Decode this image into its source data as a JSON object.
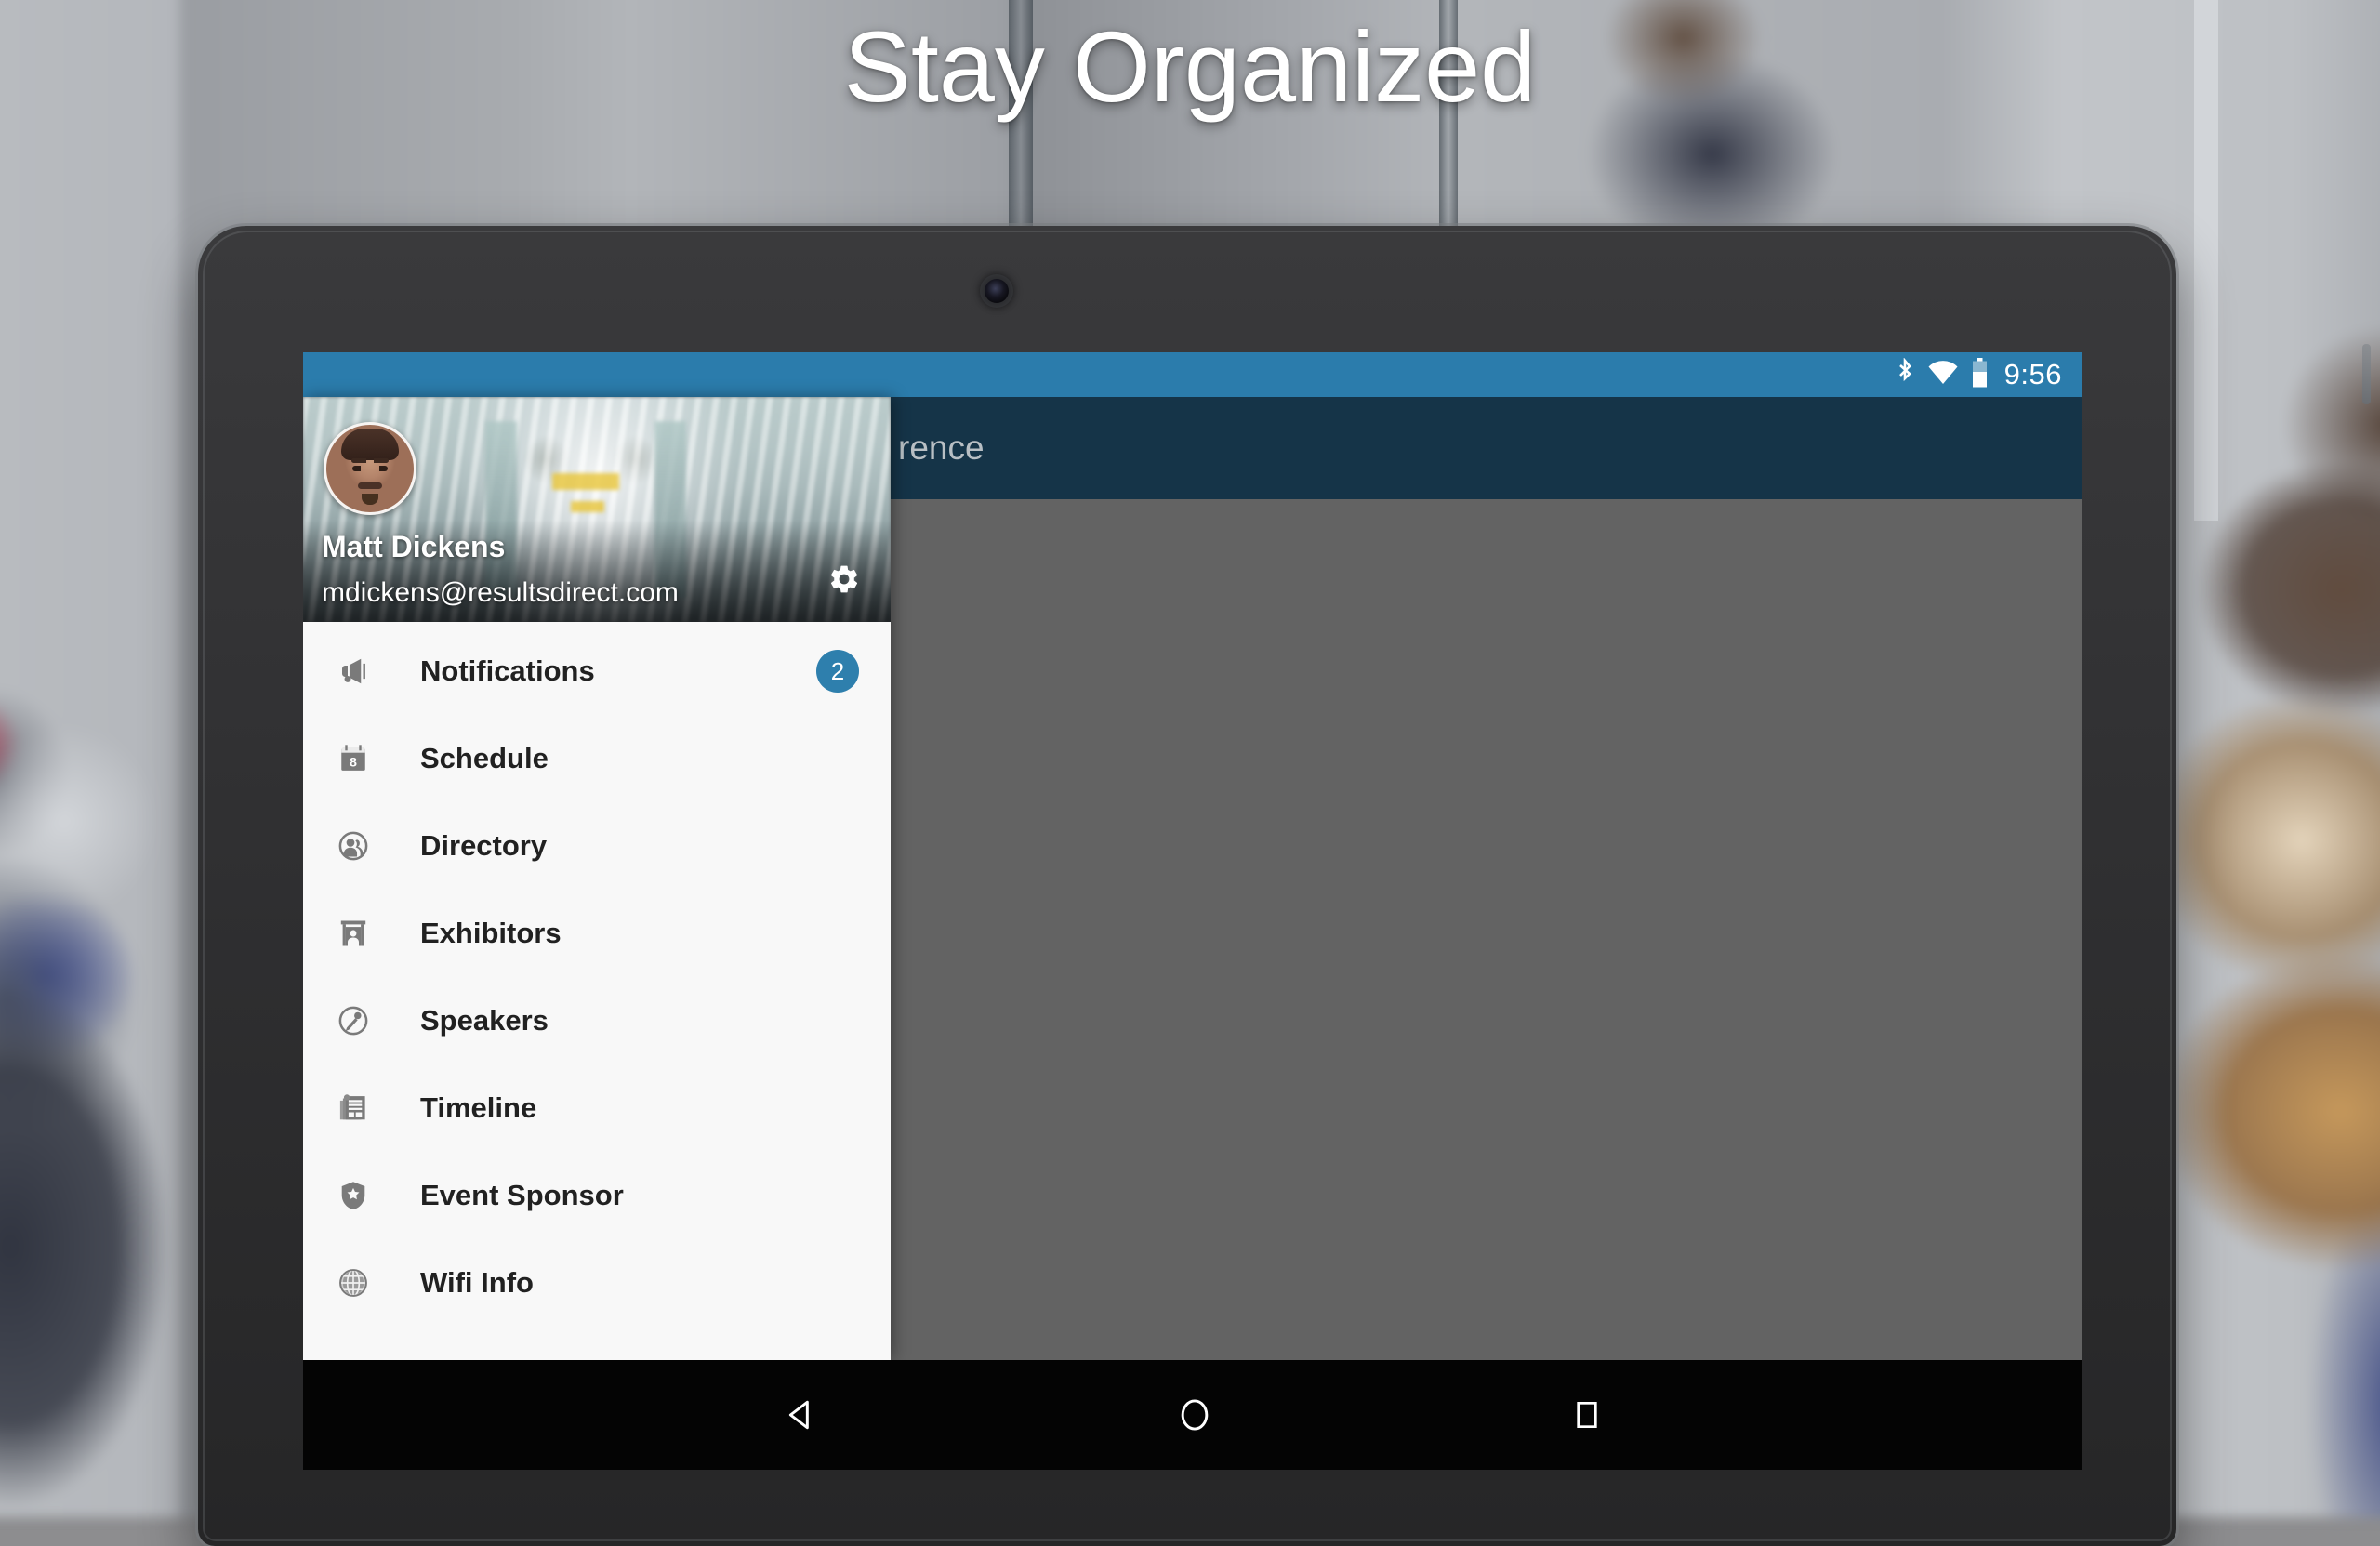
{
  "headline": "Stay Organized",
  "status_bar": {
    "bluetooth_icon": "bluetooth-icon",
    "wifi_icon": "wifi-icon",
    "battery_icon": "battery-icon",
    "time": "9:56",
    "background_color": "#2b7cac"
  },
  "app_bar": {
    "title": "rence",
    "background_color": "#153448",
    "text_color": "#b8bfc4"
  },
  "content": {
    "scrim_color": "#636363"
  },
  "drawer": {
    "background_color": "#f8f8f8",
    "header": {
      "user_name": "Matt Dickens",
      "user_email": "mdickens@resultsdirect.com",
      "avatar_name": "user-avatar",
      "settings_icon": "gear-icon",
      "cover_photo_name": "venue-atrium-photo"
    },
    "items": [
      {
        "label": "Notifications",
        "icon": "megaphone-icon",
        "badge": "2"
      },
      {
        "label": "Schedule",
        "icon": "calendar-icon",
        "badge": null
      },
      {
        "label": "Directory",
        "icon": "people-circle-icon",
        "badge": null
      },
      {
        "label": "Exhibitors",
        "icon": "exhibitor-booth-icon",
        "badge": null
      },
      {
        "label": "Speakers",
        "icon": "microphone-circle-icon",
        "badge": null
      },
      {
        "label": "Timeline",
        "icon": "news-feed-icon",
        "badge": null
      },
      {
        "label": "Event Sponsor",
        "icon": "shield-star-icon",
        "badge": null
      },
      {
        "label": "Wifi Info",
        "icon": "globe-icon",
        "badge": null
      }
    ],
    "badge_color": "#2e7fad"
  },
  "android_nav": {
    "back_icon": "back-triangle-icon",
    "home_icon": "home-circle-icon",
    "recents_icon": "recents-square-icon"
  }
}
